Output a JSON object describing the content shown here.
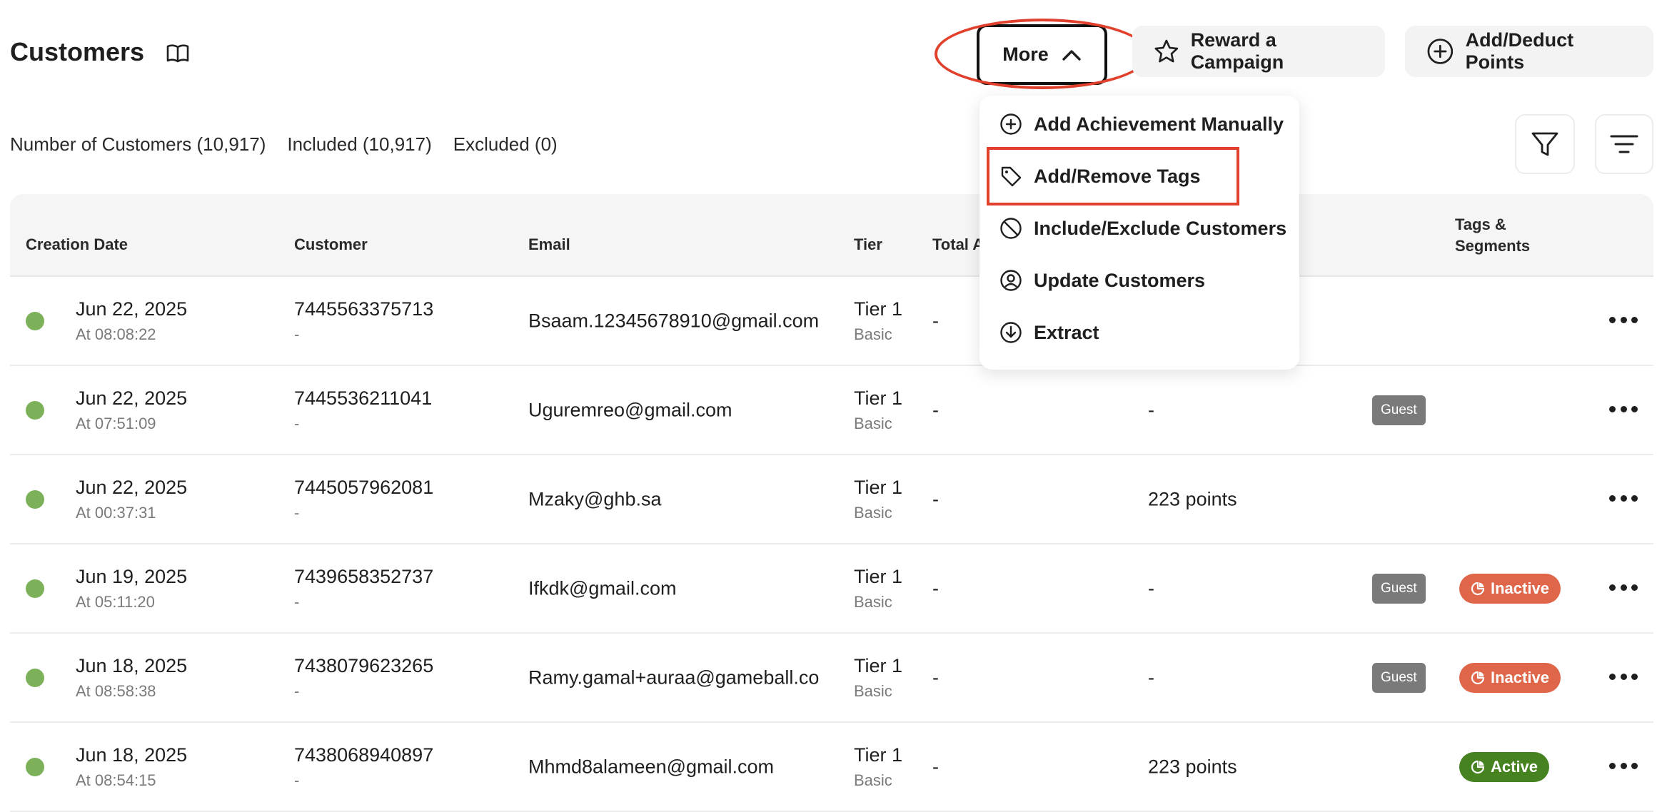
{
  "header": {
    "title": "Customers",
    "more_label": "More",
    "reward_label": "Reward a Campaign",
    "adddeduct_label": "Add/Deduct Points"
  },
  "stats": {
    "total": "Number of Customers (10,917)",
    "included": "Included (10,917)",
    "excluded": "Excluded (0)"
  },
  "more_menu": {
    "items": [
      {
        "label": "Add Achievement Manually",
        "icon": "plus-circle-icon"
      },
      {
        "label": "Add/Remove Tags",
        "icon": "tag-icon"
      },
      {
        "label": "Include/Exclude Customers",
        "icon": "ban-icon"
      },
      {
        "label": "Update Customers",
        "icon": "user-circle-icon"
      },
      {
        "label": "Extract",
        "icon": "download-circle-icon"
      }
    ]
  },
  "table": {
    "columns": {
      "creation_date": "Creation Date",
      "customer": "Customer",
      "email": "Email",
      "tier": "Tier",
      "total": "Total A",
      "tags_line1": "Tags &",
      "tags_line2": "Segments"
    },
    "rows": [
      {
        "date": "Jun 22, 2025",
        "time": "At 08:08:22",
        "customer_id": "7445563375713",
        "customer_sub": "-",
        "email": "Bsaam.12345678910@gmail.com",
        "tier": "Tier 1",
        "tier_sub": "Basic",
        "total": "-",
        "points": "",
        "guest": "",
        "status": ""
      },
      {
        "date": "Jun 22, 2025",
        "time": "At 07:51:09",
        "customer_id": "7445536211041",
        "customer_sub": "-",
        "email": "Uguremreo@gmail.com",
        "tier": "Tier 1",
        "tier_sub": "Basic",
        "total": "-",
        "points": "-",
        "guest": "Guest",
        "status": ""
      },
      {
        "date": "Jun 22, 2025",
        "time": "At 00:37:31",
        "customer_id": "7445057962081",
        "customer_sub": "-",
        "email": "Mzaky@ghb.sa",
        "tier": "Tier 1",
        "tier_sub": "Basic",
        "total": "-",
        "points": "223 points",
        "guest": "",
        "status": ""
      },
      {
        "date": "Jun 19, 2025",
        "time": "At 05:11:20",
        "customer_id": "7439658352737",
        "customer_sub": "-",
        "email": "Ifkdk@gmail.com",
        "tier": "Tier 1",
        "tier_sub": "Basic",
        "total": "-",
        "points": "-",
        "guest": "Guest",
        "status": "Inactive"
      },
      {
        "date": "Jun 18, 2025",
        "time": "At 08:58:38",
        "customer_id": "7438079623265",
        "customer_sub": "-",
        "email": "Ramy.gamal+auraa@gameball.co",
        "tier": "Tier 1",
        "tier_sub": "Basic",
        "total": "-",
        "points": "-",
        "guest": "Guest",
        "status": "Inactive"
      },
      {
        "date": "Jun 18, 2025",
        "time": "At 08:54:15",
        "customer_id": "7438068940897",
        "customer_sub": "-",
        "email": "Mhmd8alameen@gmail.com",
        "tier": "Tier 1",
        "tier_sub": "Basic",
        "total": "-",
        "points": "223 points",
        "guest": "",
        "status": "Active"
      }
    ]
  },
  "colors": {
    "accent_annotation": "#e0402c",
    "status_dot": "#7cb15a",
    "inactive": "#e0664a",
    "active": "#46821f",
    "guest_badge": "#7a7a7a"
  }
}
